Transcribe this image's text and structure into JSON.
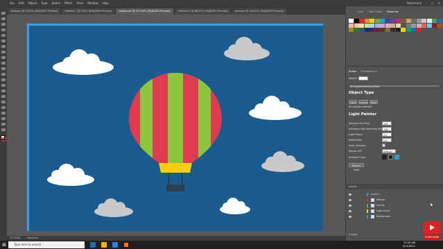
{
  "menu": {
    "items": [
      "File",
      "Edit",
      "Object",
      "Type",
      "Select",
      "Effect",
      "View",
      "Window",
      "Help"
    ],
    "user": "Rosemaris"
  },
  "tabs": [
    {
      "label": "Balloons @ 3333% (RGB/GPU Preview)",
      "active": false
    },
    {
      "label": "Untitled-1 @ 100% (RGB/GPU Preview)",
      "active": false
    },
    {
      "label": "balloon.ai* @ 377.83% (RGB/GPU Preview)",
      "active": true
    },
    {
      "label": "Untitled-3* @ 66.67% (RGB/GPU Preview)",
      "active": false
    },
    {
      "label": "Vandoor @ 116.33% (RGB/GPU Preview)",
      "active": false
    }
  ],
  "panel": {
    "top_tabs": [
      "Color",
      "Color Guide",
      "Swatches"
    ],
    "active_top_tab": "Swatches",
    "swatch_colors": [
      "#ffffff",
      "#000000",
      "#e3262d",
      "#f0852d",
      "#f7d117",
      "#6ab42d",
      "#2e9ad8",
      "#2c4ea3",
      "#7c3a96",
      "#c12a7b",
      "#8b5a2b",
      "#c9a36b",
      "#6e6e6e",
      "#9a9a9a",
      "#c8c8c8",
      "#e8e8e8",
      "#4d9c5f",
      "#1f6fb4",
      "#f2b6b6",
      "#f5c99b",
      "#fbe59a",
      "#bfe0a5",
      "#a8d3ef",
      "#a7b3dc",
      "#c8a8d6",
      "#e9a6c8",
      "#d4b08c",
      "#e8d4b4",
      "#555555",
      "#777777",
      "#999999",
      "#bbbbbb",
      "#ff5f5f",
      "#5fd0ff",
      "#8e1a1f",
      "#a4531b",
      "#a88a0a",
      "#3f7619",
      "#1b5e8a",
      "#1b2f6b",
      "#4e1f60",
      "#7a164c",
      "#5a3a1a",
      "#8a6a3a",
      "#333333",
      "#222222",
      "#ffd400",
      "#00a651",
      "#0072bc",
      "#ed1c24"
    ],
    "sub_tabs": [
      "Stroke",
      "Transparency"
    ],
    "props_label": "Weight:",
    "search_placeholder": "BitmapRenderBased/Tool",
    "object_type": {
      "title": "Object Type",
      "buttons": [
        "Light",
        "Camera",
        "Mesh"
      ],
      "status": "No objects selected"
    },
    "light_painter": {
      "title": "Light Painter",
      "fields": [
        {
          "label": "Samples Per Pixel",
          "value": "256"
        },
        {
          "label": "Maximum Ray Marching Steps",
          "value": "128"
        },
        {
          "label": "Light Reach",
          "value": "1.0"
        },
        {
          "label": "Reflectivity",
          "value": "0.0"
        },
        {
          "label": "Inner Samples",
          "value": ""
        },
        {
          "label": "Render API",
          "value": "Default"
        },
        {
          "label": "Ambient Color",
          "value": ""
        }
      ],
      "reload_button": "Refresh Level"
    },
    "layers": {
      "header": "Layers",
      "rows": [
        {
          "name": "Layer 1",
          "color": "#4d7cff"
        },
        {
          "name": "Balloon",
          "color": "#e3262d"
        },
        {
          "name": "Clouds",
          "color": "#6ab42d"
        },
        {
          "name": "Light curve",
          "color": "#f7d117"
        },
        {
          "name": "Background",
          "color": "#2e9ad8"
        }
      ],
      "footer": "1 Layer"
    }
  },
  "status": {
    "zoom": "377.83%",
    "tool": "Selection"
  },
  "taskbar": {
    "search_placeholder": "Type here to search",
    "time": "10:33 AM",
    "date": "5/15/2021"
  },
  "artwork": {
    "background_color": "#1a5c8f",
    "frame_color": "#3aa0e6",
    "balloon_colors": [
      "#e03a4e",
      "#8cc63f"
    ],
    "basket_color": "#f5d000",
    "cloud_colors": [
      "#ffffff",
      "#c9c9c9"
    ]
  },
  "overlay": {
    "subscribe_label": "SUBSCRIBE"
  }
}
